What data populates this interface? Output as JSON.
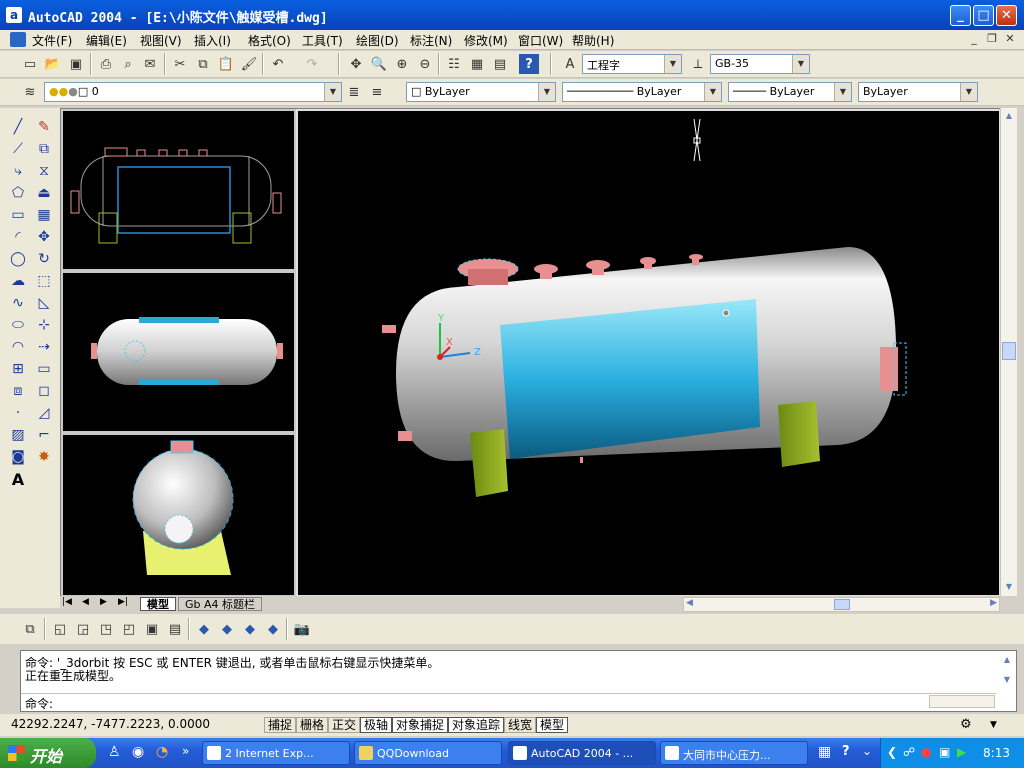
{
  "window": {
    "title": "AutoCAD 2004 - [E:\\小陈文件\\触媒受槽.dwg]",
    "app_icon_letter": "a"
  },
  "menu": [
    "文件(F)",
    "编辑(E)",
    "视图(V)",
    "插入(I)",
    "格式(O)",
    "工具(T)",
    "绘图(D)",
    "标注(N)",
    "修改(M)",
    "窗口(W)",
    "帮助(H)"
  ],
  "toolbar": {
    "text_style": "工程字",
    "dim_style": "GB-35"
  },
  "properties": {
    "layer": "0",
    "color": "ByLayer",
    "linetype": "ByLayer",
    "lineweight": "ByLayer",
    "plotstyle": "ByLayer"
  },
  "layout_tabs": [
    "模型",
    "Gb A4 标题栏"
  ],
  "command": {
    "history_1": "命令: '_3dorbit 按 ESC 或 ENTER 键退出, 或者单击鼠标右键显示快捷菜单。",
    "history_2": "正在重生成模型。",
    "prompt": "命令:"
  },
  "status": {
    "coords": "42292.2247, -7477.2223, 0.0000",
    "toggles": [
      "捕捉",
      "栅格",
      "正交",
      "极轴",
      "对象捕捉",
      "对象追踪",
      "线宽",
      "模型"
    ],
    "active_toggles": [
      "极轴",
      "对象捕捉",
      "对象追踪",
      "模型"
    ]
  },
  "ucs": {
    "x": "X",
    "y": "Y",
    "z": "Z"
  },
  "taskbar": {
    "start_label": "开始",
    "tasks": [
      "2 Internet Exp...",
      "QQDownload",
      "AutoCAD 2004 - ...",
      "大同市中心压力..."
    ],
    "active_task": "AutoCAD 2004 - ...",
    "clock": "8:13"
  },
  "colors": {
    "vessel": "#d8d8d8",
    "band": "#2aa8d8",
    "nozzle": "#e89090",
    "saddle": "#8aaa20",
    "titlebar": "#0a5fe0"
  }
}
